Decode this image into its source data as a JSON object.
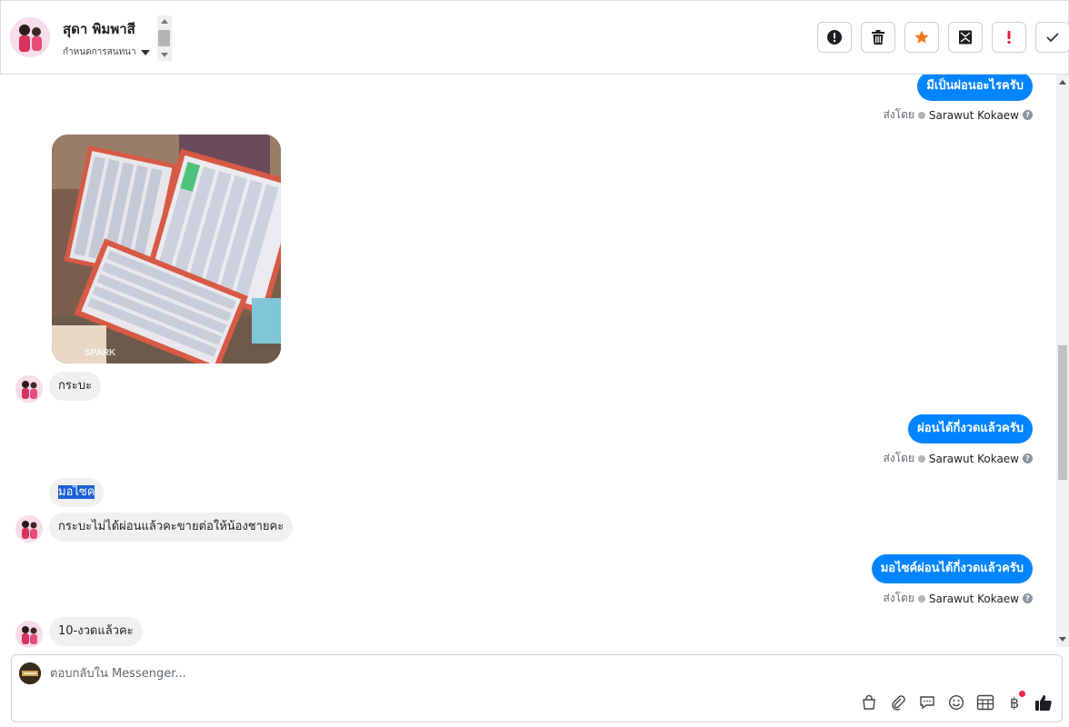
{
  "header": {
    "contact_name": "สุดา พิมพาสี",
    "conversation_status": "กำหนดการสนทนา",
    "tool_buttons": [
      {
        "name": "spam-button",
        "icon": "exclamation-circle-icon"
      },
      {
        "name": "delete-button",
        "icon": "trash-icon"
      },
      {
        "name": "star-button",
        "icon": "star-icon"
      },
      {
        "name": "mark-unread-button",
        "icon": "envelope-icon"
      },
      {
        "name": "important-button",
        "icon": "exclamation-icon"
      },
      {
        "name": "done-button",
        "icon": "check-icon"
      }
    ]
  },
  "messages": {
    "out1": {
      "text": "มีเป็นผ่อนอะไรครับ",
      "sent_by_label": "ส่งโดย",
      "agent": "Sarawut Kokaew"
    },
    "in1": {
      "text": "กระบะ"
    },
    "out2": {
      "text": "ผ่อนได้กี่งวดแล้วครับ",
      "sent_by_label": "ส่งโดย",
      "agent": "Sarawut Kokaew"
    },
    "in2": {
      "text": "มอไซค"
    },
    "in3": {
      "text": "กระบะไม่ได้ผ่อนแล้วคะขายต่อให้น้องชายคะ"
    },
    "out3": {
      "text": "มอไซค์ผ่อนได้กี่งวดแล้วครับ",
      "sent_by_label": "ส่งโดย",
      "agent": "Sarawut Kokaew"
    },
    "in4": {
      "text": "10-งวดแล้วคะ"
    },
    "photo_watermark": "SPARK"
  },
  "composer": {
    "placeholder": "ตอบกลับใน Messenger...",
    "tools": [
      "shopping-bag-icon",
      "paperclip-icon",
      "speech-bubble-icon",
      "emoji-icon",
      "table-icon",
      "baht-icon",
      "thumbs-up-icon"
    ],
    "baht_symbol": "฿"
  },
  "colors": {
    "outgoing_bubble": "#0084ff",
    "incoming_bubble": "#f0f0f0",
    "star_orange": "#f5761a",
    "alert_red": "#e41e3f"
  }
}
